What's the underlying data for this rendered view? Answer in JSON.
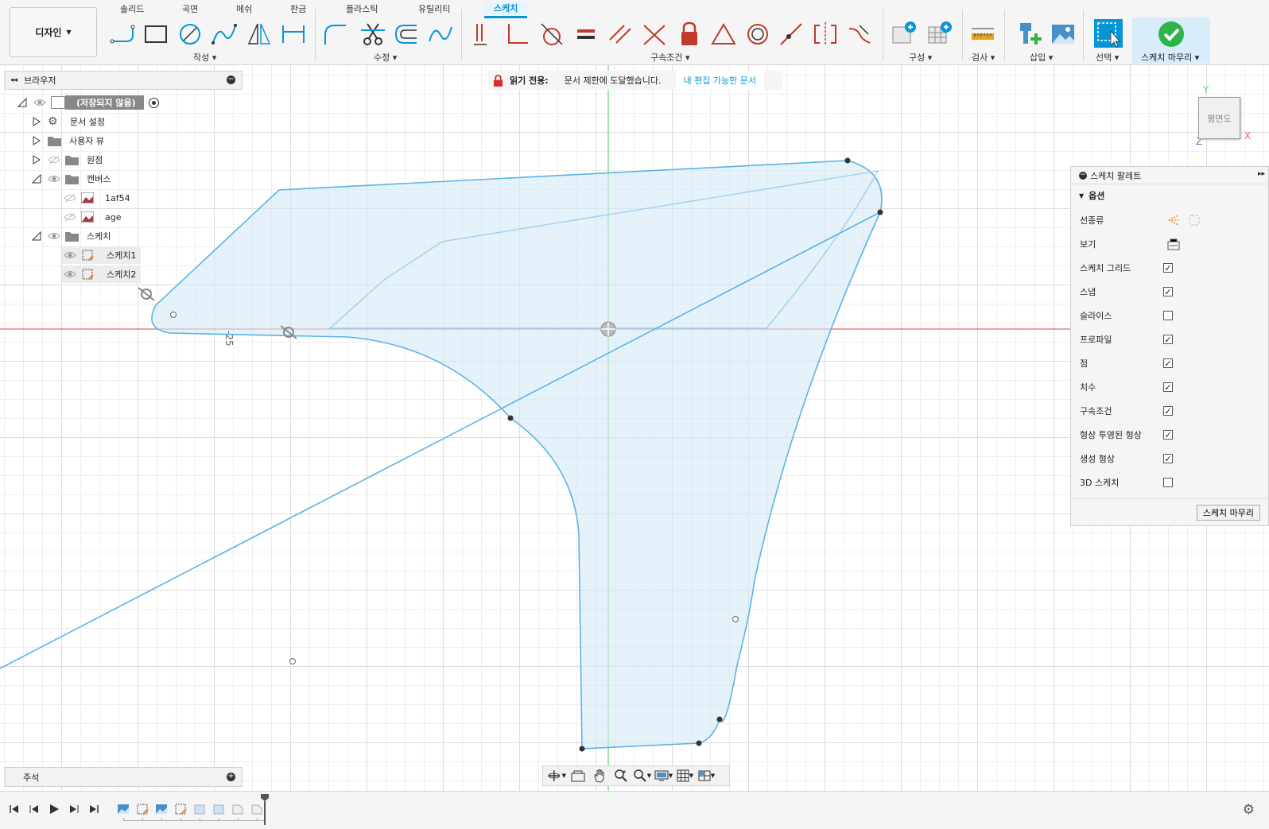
{
  "toolbar": {
    "workspace_label": "디자인",
    "tabs": [
      "솔리드",
      "곡면",
      "메쉬",
      "판금",
      "플라스틱",
      "유틸리티",
      "스케치"
    ],
    "groups": {
      "create": "작성",
      "modify": "수정",
      "constraints": "구속조건",
      "construct": "구성",
      "inspect": "검사",
      "insert": "삽입",
      "select": "선택",
      "finish": "스케치 마무리"
    }
  },
  "browser": {
    "title": "브라우저",
    "root": "(저장되지 않음)",
    "items": [
      "문서 설정",
      "사용자 뷰",
      "원점",
      "캔버스",
      "1af54",
      "age",
      "스케치",
      "스케치1",
      "스케치2"
    ]
  },
  "banner": {
    "label": "읽기 전용:",
    "message": "문서 제한에 도달했습니다.",
    "link": "내 편집 가능한 문서"
  },
  "viewcube": {
    "face": "평면도",
    "axis_x": "X",
    "axis_y": "Y",
    "axis_z": "Z"
  },
  "sketch": {
    "dimension_label": "-25"
  },
  "palette": {
    "title": "스케치 팔레트",
    "section": "옵션",
    "rows": [
      {
        "label": "선종류",
        "type": "icons"
      },
      {
        "label": "보기",
        "type": "icon"
      },
      {
        "label": "스케치 그리드",
        "checked": true
      },
      {
        "label": "스냅",
        "checked": true
      },
      {
        "label": "슬라이스",
        "checked": false
      },
      {
        "label": "프로파일",
        "checked": true
      },
      {
        "label": "점",
        "checked": true
      },
      {
        "label": "치수",
        "checked": true
      },
      {
        "label": "구속조건",
        "checked": true
      },
      {
        "label": "형상 투영된 형상",
        "checked": true
      },
      {
        "label": "생성 형상",
        "checked": true
      },
      {
        "label": "3D 스케치",
        "checked": false
      }
    ],
    "finish_button": "스케치 마무리"
  },
  "notes": {
    "title": "주석"
  },
  "colors": {
    "accent": "#0696d7",
    "sketch_line": "#5ab4e5",
    "profile_fill": "#d4e9f7",
    "x_axis": "#e06666",
    "y_axis": "#6ad06a",
    "finish_green": "#2fb44a"
  }
}
